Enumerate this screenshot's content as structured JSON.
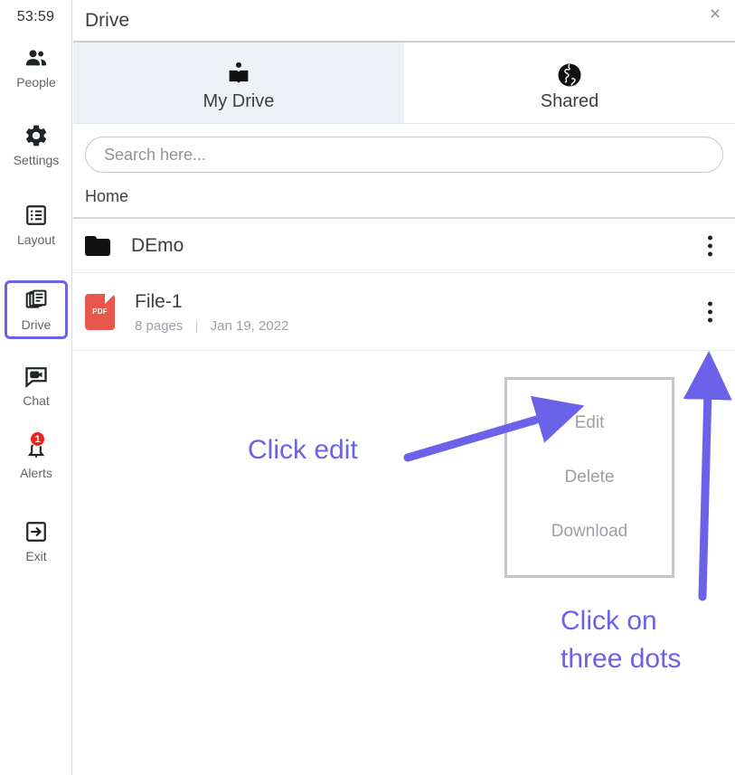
{
  "sidebar": {
    "timer": "53:59",
    "items": [
      {
        "label": "People",
        "icon": "people-icon",
        "active": false
      },
      {
        "label": "Settings",
        "icon": "gear-icon",
        "active": false
      },
      {
        "label": "Layout",
        "icon": "layout-icon",
        "active": false
      },
      {
        "label": "Drive",
        "icon": "drive-icon",
        "active": true
      },
      {
        "label": "Chat",
        "icon": "chat-video-icon",
        "active": false
      },
      {
        "label": "Alerts",
        "icon": "bell-icon",
        "active": false,
        "badge": "1"
      },
      {
        "label": "Exit",
        "icon": "exit-icon",
        "active": false
      }
    ]
  },
  "header": {
    "title": "Drive",
    "close_label": "×"
  },
  "tabs": [
    {
      "label": "My Drive",
      "icon": "open-book-icon",
      "active": true
    },
    {
      "label": "Shared",
      "icon": "globe-icon",
      "active": false
    }
  ],
  "search": {
    "placeholder": "Search here...",
    "value": ""
  },
  "breadcrumb": "Home",
  "rows": [
    {
      "type": "folder",
      "name": "DEmo",
      "icon": "folder-icon"
    },
    {
      "type": "file",
      "name": "File-1",
      "icon": "pdf-file-icon",
      "icon_text": "PDF",
      "pages": "8 pages",
      "separator": "|",
      "date": "Jan 19, 2022"
    }
  ],
  "context_menu": {
    "items": [
      "Edit",
      "Delete",
      "Download"
    ]
  },
  "annotations": [
    {
      "id": "click-edit",
      "text": "Click edit"
    },
    {
      "id": "click-dots",
      "line1": "Click on",
      "line2": "three dots"
    }
  ],
  "colors": {
    "accent": "#6a62e8",
    "badge": "#e8241b",
    "pdf": "#e9564b",
    "active_tab_bg": "#eef2f7",
    "text": "#3c4043",
    "muted": "#9aa0a6"
  }
}
